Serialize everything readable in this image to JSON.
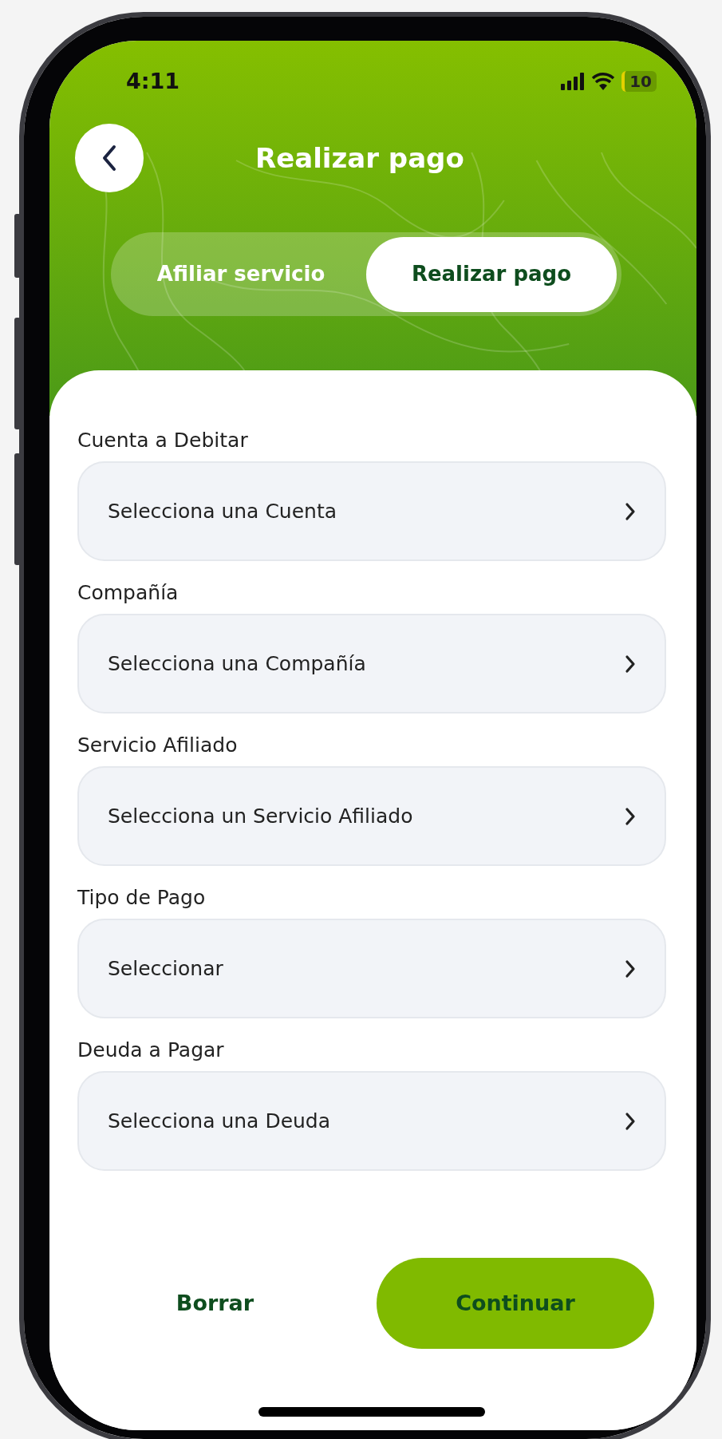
{
  "status_bar": {
    "time": "4:11",
    "battery": "10"
  },
  "header": {
    "title": "Realizar pago"
  },
  "tabs": [
    {
      "label": "Afiliar servicio",
      "selected": false
    },
    {
      "label": "Realizar pago",
      "selected": true
    }
  ],
  "fields": [
    {
      "label": "Cuenta a Debitar",
      "placeholder": "Selecciona una Cuenta"
    },
    {
      "label": "Compañía",
      "placeholder": "Selecciona una Compañía"
    },
    {
      "label": "Servicio Afiliado",
      "placeholder": "Selecciona un Servicio Afiliado"
    },
    {
      "label": "Tipo de Pago",
      "placeholder": "Seleccionar"
    },
    {
      "label": "Deuda a Pagar",
      "placeholder": "Selecciona una Deuda"
    }
  ],
  "buttons": [
    {
      "label": "Borrar",
      "kind": "text"
    },
    {
      "label": "Continuar",
      "kind": "primary"
    }
  ]
}
